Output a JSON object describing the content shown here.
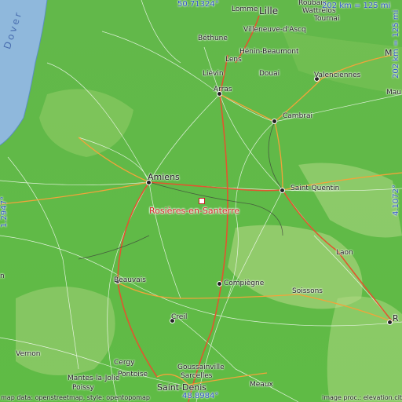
{
  "map": {
    "focus_city": "Rosières-en-Santerre",
    "lat_top": "50.71324°",
    "lat_bottom": "48.8984°",
    "lon_left": "1.2947°",
    "lon_right": "4.1072°",
    "scale_top": "202 km = 125 mi",
    "scale_right": "202 km = 125 mi",
    "sea_label": "Dover",
    "attribution_left": "map data: openstreetmap, style: opentopomap",
    "attribution_right": "image proc.: elevation.city"
  },
  "places": [
    {
      "name": "Lomme"
    },
    {
      "name": "Lille"
    },
    {
      "name": "Roubaix"
    },
    {
      "name": "Tournai"
    },
    {
      "name": "Wattrelos"
    },
    {
      "name": "Villeneuve-d'Ascq"
    },
    {
      "name": "Béthune"
    },
    {
      "name": "Hénin-Beaumont"
    },
    {
      "name": "Lens"
    },
    {
      "name": "Liévin"
    },
    {
      "name": "Douai"
    },
    {
      "name": "Valenciennes"
    },
    {
      "name": "Arras"
    },
    {
      "name": "Cambrai"
    },
    {
      "name": "Amiens"
    },
    {
      "name": "Saint-Quentin"
    },
    {
      "name": "Laon"
    },
    {
      "name": "Beauvais"
    },
    {
      "name": "Compiègne"
    },
    {
      "name": "Soissons"
    },
    {
      "name": "Creil"
    },
    {
      "name": "Vernon"
    },
    {
      "name": "Cergy"
    },
    {
      "name": "Goussainville"
    },
    {
      "name": "Sarcelles"
    },
    {
      "name": "Pontoise"
    },
    {
      "name": "Mantes-la-Jolie"
    },
    {
      "name": "Poissy"
    },
    {
      "name": "Saint-Denis"
    },
    {
      "name": "Meaux"
    },
    {
      "name": "R"
    },
    {
      "name": "M"
    },
    {
      "name": "Mau"
    },
    {
      "name": "n"
    }
  ],
  "colors": {
    "focus": "#d42a2a",
    "coords": "#2f57c7",
    "sea": "#8fb8dc"
  }
}
